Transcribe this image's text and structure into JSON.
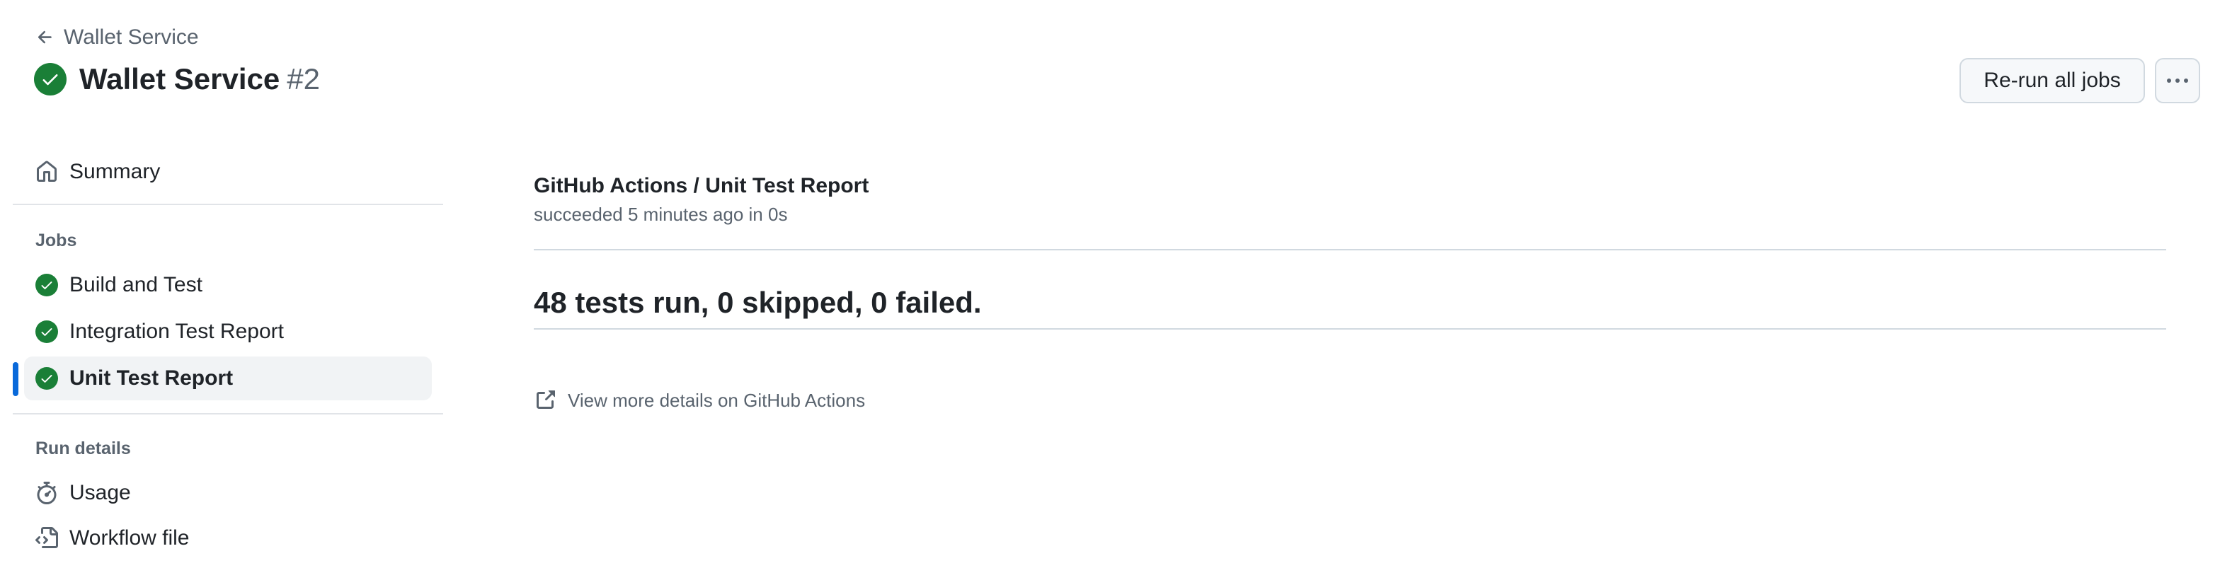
{
  "header": {
    "back_label": "Wallet Service",
    "title": "Wallet Service",
    "run_number": "#2",
    "rerun_label": "Re-run all jobs"
  },
  "sidebar": {
    "summary_label": "Summary",
    "jobs_heading": "Jobs",
    "jobs": [
      {
        "label": "Build and Test",
        "status": "success"
      },
      {
        "label": "Integration Test Report",
        "status": "success"
      },
      {
        "label": "Unit Test Report",
        "status": "success",
        "selected": true
      }
    ],
    "run_details_heading": "Run details",
    "run_details": [
      {
        "label": "Usage",
        "icon": "stopwatch-icon"
      },
      {
        "label": "Workflow file",
        "icon": "file-code-icon"
      }
    ]
  },
  "main": {
    "job_title": "GitHub Actions / Unit Test Report",
    "job_meta": "succeeded 5 minutes ago in 0s",
    "summary": "48 tests run, 0 skipped, 0 failed.",
    "details_link": "View more details on GitHub Actions"
  },
  "colors": {
    "success": "#1a7f37",
    "accent": "#0969da",
    "muted": "#59636e"
  }
}
